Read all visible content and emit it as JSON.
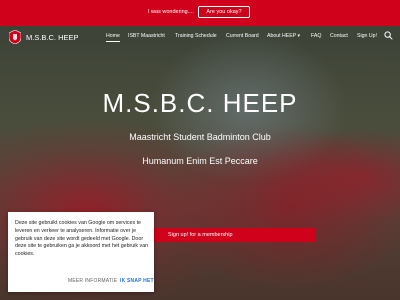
{
  "topbar": {
    "message": "I was wondering....",
    "button_label": "Are you okay?"
  },
  "site": {
    "logo_text": "M.S.B.C. HEEP",
    "logo_icon": "badge-icon"
  },
  "nav": {
    "items": [
      {
        "label": "Home",
        "active": true
      },
      {
        "label": "ISBT Maastricht"
      },
      {
        "label": "Training Schedule"
      },
      {
        "label": "Current Board"
      },
      {
        "label": "About HEEP ▾"
      },
      {
        "label": "FAQ"
      },
      {
        "label": "Contact"
      },
      {
        "label": "Sign Up!"
      }
    ],
    "search_icon": "search-icon"
  },
  "hero": {
    "title": "M.S.B.C. HEEP",
    "subtitle": "Maastricht Student Badminton Club",
    "motto": "Humanum Enim Est Peccare",
    "signup_label": "Sign up! for a membership"
  },
  "cookie": {
    "text": "Deze site gebruikt cookies van Google om services te leveren en verkeer te analyseren. Informatie over je gebruik van deze site wordt gedeeld met Google. Door deze site te gebruiken ga je akkoord met het gebruik van cookies.",
    "more_label": "MEER INFORMATIE",
    "ok_label": "IK SNAP HET"
  },
  "colors": {
    "brand_red": "#d0021b",
    "link_blue": "#1a73e8"
  }
}
